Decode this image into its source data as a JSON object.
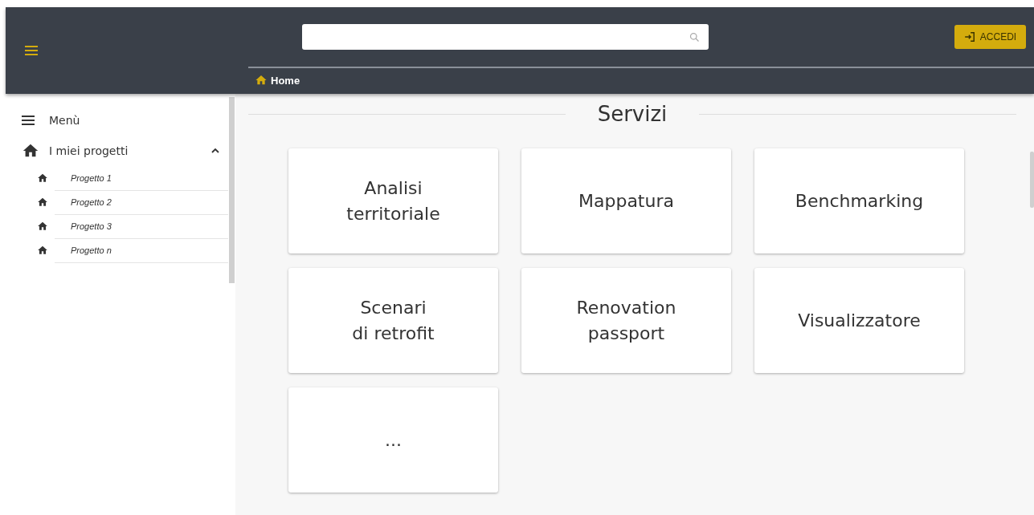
{
  "header": {
    "login_button": "ACCEDI",
    "breadcrumb": "Home"
  },
  "sidebar": {
    "menu_label": "Menù",
    "section": {
      "label": "I miei progetti",
      "expanded": true,
      "children": [
        {
          "label": "Progetto 1"
        },
        {
          "label": "Progetto 2"
        },
        {
          "label": "Progetto 3"
        },
        {
          "label": "Progetto n"
        }
      ]
    }
  },
  "main": {
    "title": "Servizi",
    "cards": [
      {
        "label": "Analisi\nterritoriale"
      },
      {
        "label": "Mappatura"
      },
      {
        "label": "Benchmarking"
      },
      {
        "label": "Scenari\ndi retrofit"
      },
      {
        "label": "Renovation\npassport"
      },
      {
        "label": "Visualizzatore"
      },
      {
        "label": "..."
      }
    ]
  }
}
